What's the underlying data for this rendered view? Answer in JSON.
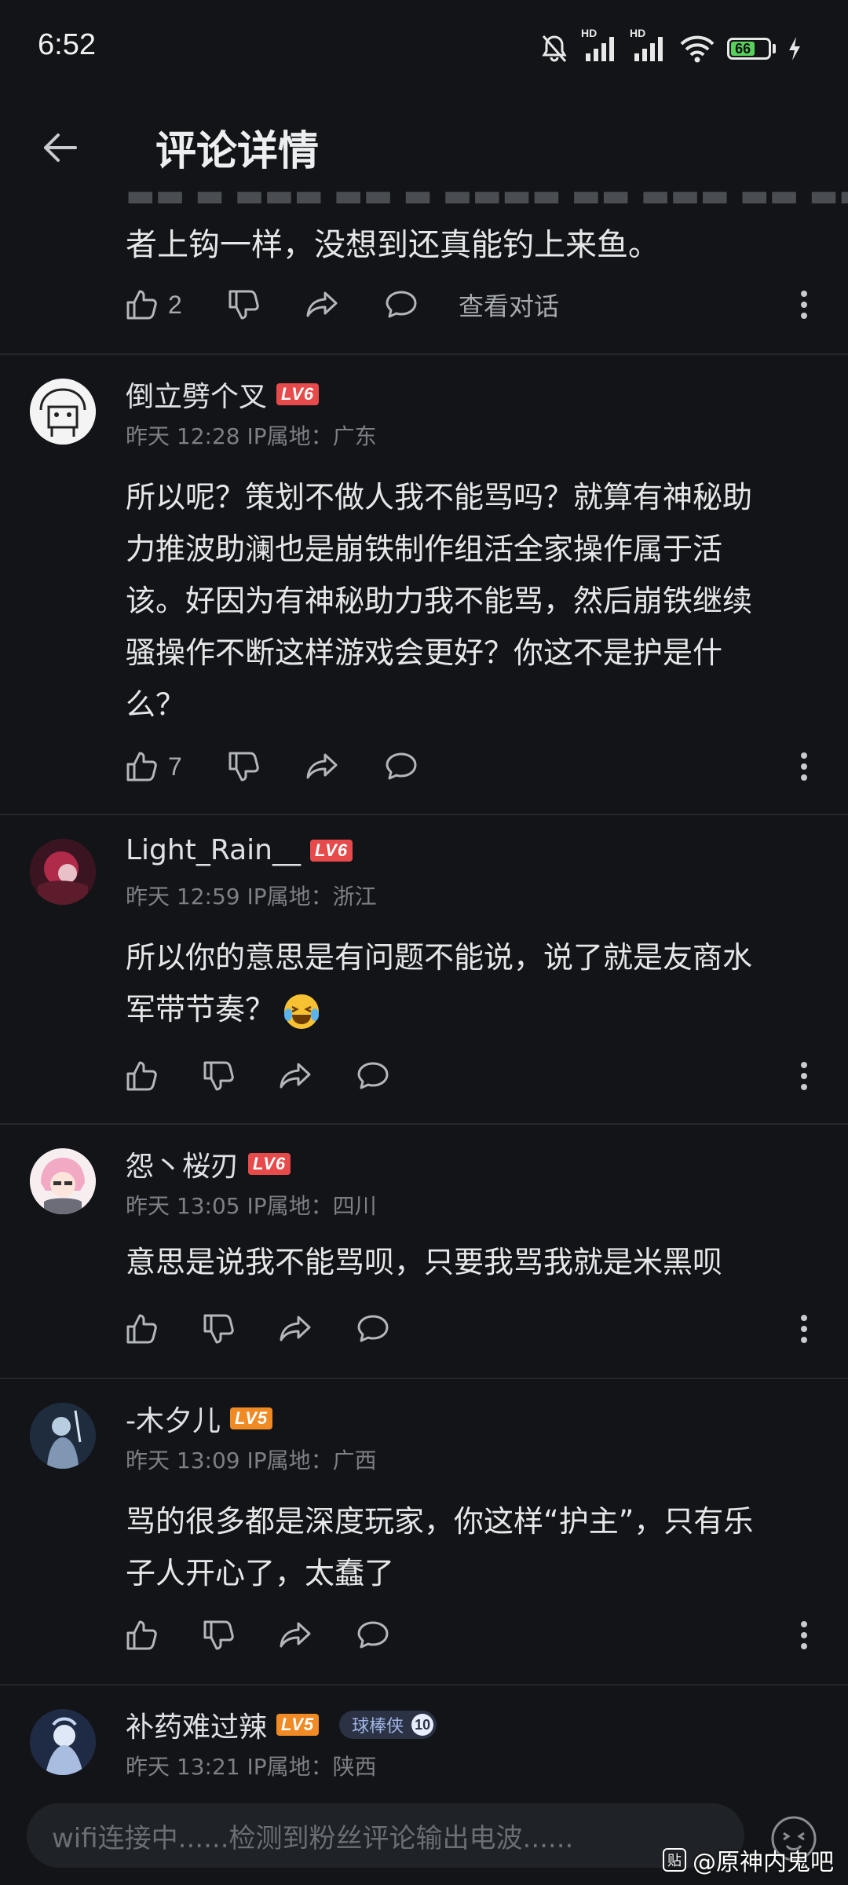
{
  "status_bar": {
    "time": "6:52",
    "battery_level": "66",
    "signal_label_1": "HD",
    "signal_label_2": "HD"
  },
  "header": {
    "title": "评论详情"
  },
  "partial_comment": {
    "text": "者上钩一样，没想到还真能钓上来鱼。",
    "likes": "2",
    "view_conversation": "查看对话"
  },
  "comments": [
    {
      "username": "倒立劈个叉",
      "level": "LV6",
      "time": "昨天 12:28",
      "ip": "IP属地：广东",
      "text_lines": [
        "所以呢？策划不做人我不能骂吗？就算有神秘助",
        "力推波助澜也是崩铁制作组活全家操作属于活",
        "该。好因为有神秘助力我不能骂，然后崩铁继续",
        "骚操作不断这样游戏会更好？你这不是护是什",
        "么？"
      ],
      "likes": "7"
    },
    {
      "username": "Light_Rain__",
      "level": "LV6",
      "time": "昨天 12:59",
      "ip": "IP属地：浙江",
      "text_lines": [
        "所以你的意思是有问题不能说，说了就是友商水",
        "军带节奏？"
      ],
      "likes": ""
    },
    {
      "username": "怨丶桜刃",
      "level": "LV6",
      "time": "昨天 13:05",
      "ip": "IP属地：四川",
      "text_lines": [
        "意思是说我不能骂呗，只要我骂我就是米黑呗"
      ],
      "likes": ""
    },
    {
      "username": "-木夕儿",
      "level": "LV5",
      "time": "昨天 13:09",
      "ip": "IP属地：广西",
      "text_lines": [
        "骂的很多都是深度玩家，你这样“护主”，只有乐",
        "子人开心了，太蠢了"
      ],
      "likes": ""
    },
    {
      "username": "补药难过辣",
      "level": "LV5",
      "fan_badge": "球棒侠",
      "fan_level": "10",
      "time": "昨天 13:21",
      "ip": "IP属地：陕西"
    }
  ],
  "input": {
    "placeholder": "wifi连接中......检测到粉丝评论输出电波......"
  },
  "watermark": {
    "logo": "贴",
    "text": "@原神内鬼吧"
  }
}
